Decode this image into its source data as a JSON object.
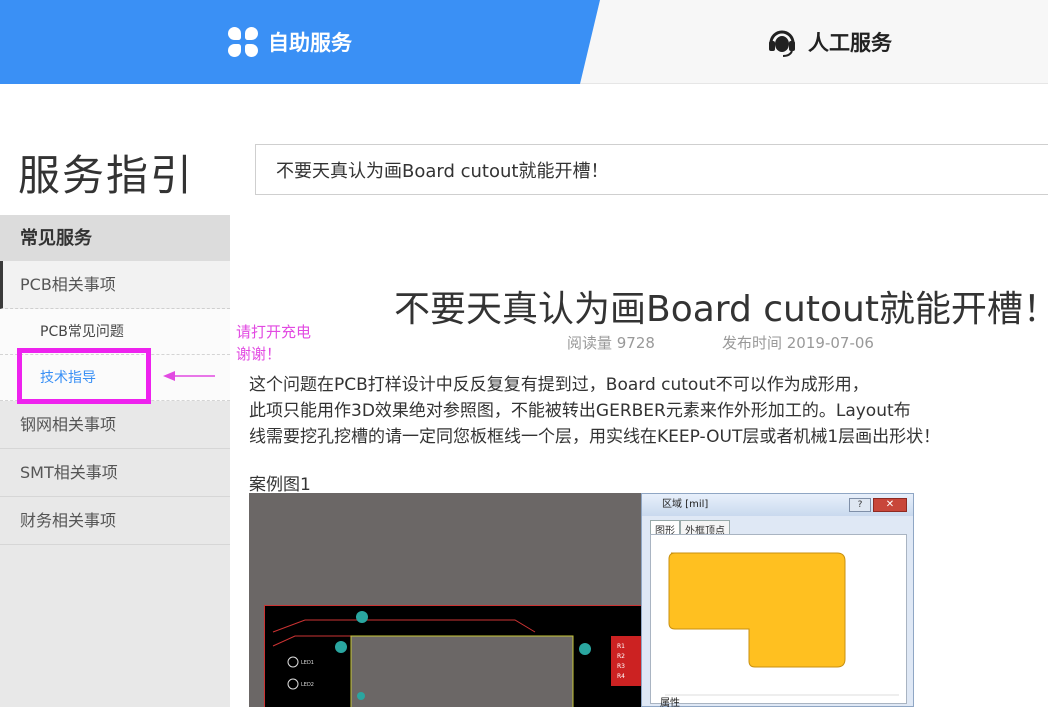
{
  "header": {
    "self_service_label": "自助服务",
    "human_service_label": "人工服务",
    "accent_color": "#3a90f5"
  },
  "page": {
    "title": "服务指引"
  },
  "search": {
    "value": "不要天真认为画Board cutout就能开槽！"
  },
  "sidebar": {
    "heading": "常见服务",
    "items": [
      {
        "label": "PCB相关事项"
      },
      {
        "label": "PCB常见问题"
      },
      {
        "label": "技术指导"
      },
      {
        "label": "钢网相关事项"
      },
      {
        "label": "SMT相关事项"
      },
      {
        "label": "财务相关事项"
      }
    ]
  },
  "annotation": {
    "line1": "请打开充电",
    "line2": "谢谢！",
    "color": "#ee22ee"
  },
  "article": {
    "title": "不要天真认为画Board cutout就能开槽！",
    "reads": "阅读量 9728",
    "published": "发布时间 2019-07-06",
    "paragraph_line1": "这个问题在PCB打样设计中反反复复有提到过，Board cutout不可以作为成形用，",
    "paragraph_line2": "此项只能用作3D效果绝对参照图，不能被转出GERBER元素来作外形加工的。Layout布",
    "paragraph_line3": "线需要挖孔挖槽的请一定同您板框线一个层，用实线在KEEP-OUT层或者机械1层画出形状！",
    "case_label": "案例图1"
  },
  "figure": {
    "dialog_title": "区域 [mil]",
    "help_button": "?",
    "close_button": "✕",
    "tab_shape": "图形",
    "tab_vertices": "外框顶点",
    "properties_label": "属性",
    "shape_color": "#ffc020",
    "pcb_labels": [
      "LED1",
      "LED2",
      "R1",
      "R2",
      "R3",
      "R4"
    ]
  }
}
